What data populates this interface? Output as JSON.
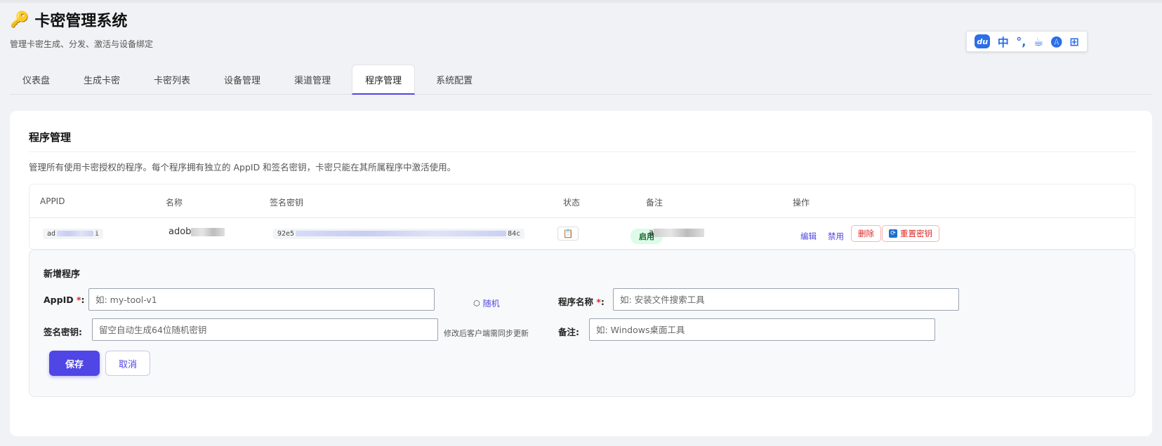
{
  "app": {
    "icon": "key-icon",
    "title": "卡密管理系统",
    "subtitle": "管理卡密生成、分发、激活与设备绑定"
  },
  "ime": {
    "items": [
      "中",
      "°,",
      "☕",
      "🅐",
      "⊞"
    ]
  },
  "tabs": [
    {
      "label": "仪表盘",
      "active": false
    },
    {
      "label": "生成卡密",
      "active": false
    },
    {
      "label": "卡密列表",
      "active": false
    },
    {
      "label": "设备管理",
      "active": false
    },
    {
      "label": "渠道管理",
      "active": false
    },
    {
      "label": "程序管理",
      "active": true
    },
    {
      "label": "系统配置",
      "active": false
    }
  ],
  "section": {
    "title": "程序管理",
    "description": "管理所有使用卡密授权的程序。每个程序拥有独立的 AppID 和签名密钥，卡密只能在其所属程序中激活使用。"
  },
  "table": {
    "columns": [
      "APPID",
      "名称",
      "签名密钥",
      "状态",
      "备注",
      "操作"
    ],
    "rows": [
      {
        "appid_prefix": "ad",
        "appid_suffix": "i",
        "name_prefix": "adob",
        "key_prefix": "92e5",
        "key_suffix": "84c",
        "status": "启用",
        "note_prefix": "a",
        "actions": {
          "edit": "编辑",
          "disable": "禁用",
          "delete": "删除",
          "reset_key": "重置密钥"
        }
      }
    ]
  },
  "form": {
    "title": "新增程序",
    "appid_label": "AppID",
    "appid_placeholder": "如: my-tool-v1",
    "random_label": "随机",
    "name_label": "程序名称",
    "name_placeholder": "如: 安装文件搜索工具",
    "key_label": "签名密钥:",
    "key_placeholder": "留空自动生成64位随机密钥",
    "key_hint": "修改后客户端需同步更新",
    "note_label": "备注:",
    "note_placeholder": "如: Windows桌面工具",
    "save": "保存",
    "cancel": "取消"
  },
  "colors": {
    "accent": "#4f46e5",
    "danger": "#dc2626",
    "success_bg": "#dcfce7",
    "success_text": "#166534"
  }
}
